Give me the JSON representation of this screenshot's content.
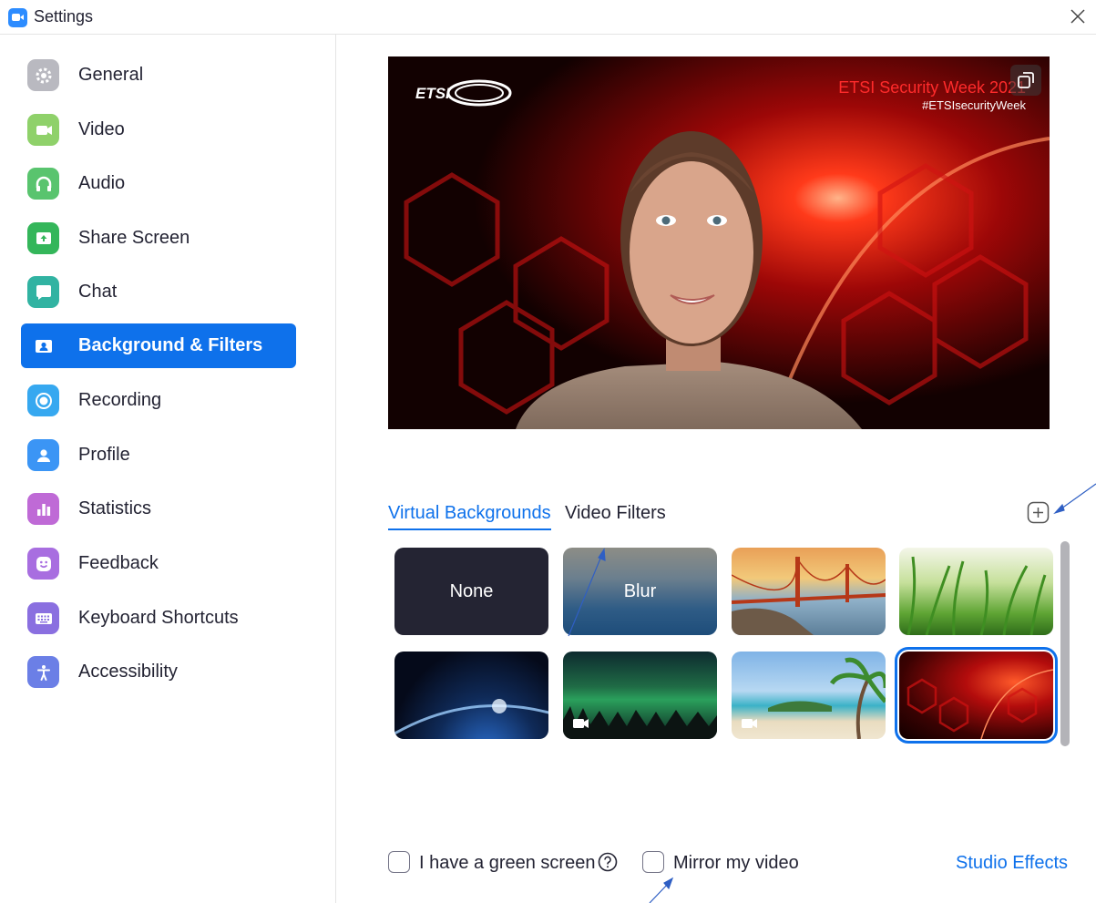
{
  "window": {
    "title": "Settings"
  },
  "sidebar": {
    "items": [
      {
        "label": "General",
        "icon": "gear-icon",
        "color": "#b9b9c0"
      },
      {
        "label": "Video",
        "icon": "video-camera-icon",
        "color": "#8fd16a"
      },
      {
        "label": "Audio",
        "icon": "headphones-icon",
        "color": "#59c46e"
      },
      {
        "label": "Share Screen",
        "icon": "share-screen-icon",
        "color": "#34b65a"
      },
      {
        "label": "Chat",
        "icon": "chat-bubble-icon",
        "color": "#31b3a2"
      },
      {
        "label": "Background & Filters",
        "icon": "portrait-icon",
        "color": "#0e71eb",
        "active": true
      },
      {
        "label": "Recording",
        "icon": "record-icon",
        "color": "#36a8f0"
      },
      {
        "label": "Profile",
        "icon": "person-icon",
        "color": "#3b95f5"
      },
      {
        "label": "Statistics",
        "icon": "bar-chart-icon",
        "color": "#bf6ad6"
      },
      {
        "label": "Feedback",
        "icon": "smiley-icon",
        "color": "#a86ee0"
      },
      {
        "label": "Keyboard Shortcuts",
        "icon": "keyboard-icon",
        "color": "#8a6fe0"
      },
      {
        "label": "Accessibility",
        "icon": "accessibility-icon",
        "color": "#6b7fe6"
      }
    ]
  },
  "preview": {
    "logo_text": "ETSI",
    "event_title": "ETSI Security Week 2021",
    "hashtag": "#ETSIsecurityWeek"
  },
  "tabs": [
    {
      "label": "Virtual Backgrounds",
      "active": true
    },
    {
      "label": "Video Filters",
      "active": false
    }
  ],
  "backgrounds": [
    {
      "label": "None",
      "kind": "none"
    },
    {
      "label": "Blur",
      "kind": "blur"
    },
    {
      "label": "",
      "kind": "golden-gate"
    },
    {
      "label": "",
      "kind": "grass"
    },
    {
      "label": "",
      "kind": "earth"
    },
    {
      "label": "",
      "kind": "aurora",
      "video": true
    },
    {
      "label": "",
      "kind": "beach",
      "video": true
    },
    {
      "label": "",
      "kind": "etsi",
      "selected": true
    }
  ],
  "options": {
    "green_screen_label": "I have a green screen",
    "mirror_label": "Mirror my video",
    "studio_effects_label": "Studio Effects"
  },
  "colors": {
    "accent": "#0e71eb"
  }
}
